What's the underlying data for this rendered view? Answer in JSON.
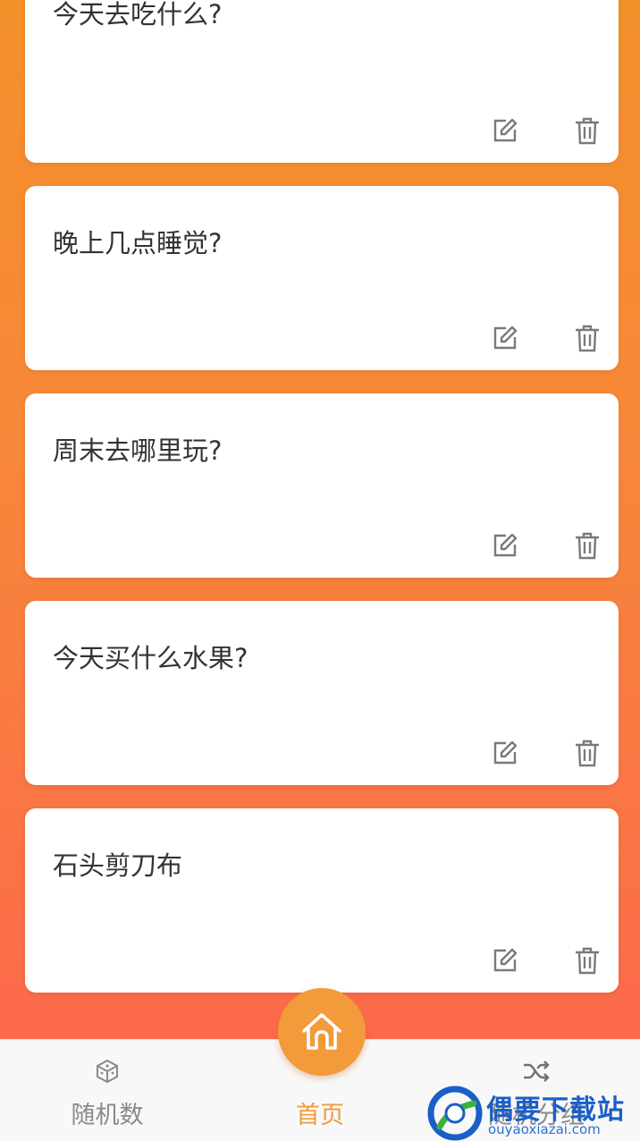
{
  "cards": [
    {
      "title": "今天去吃什么?"
    },
    {
      "title": "晚上几点睡觉?"
    },
    {
      "title": "周末去哪里玩?"
    },
    {
      "title": "今天买什么水果?"
    },
    {
      "title": "石头剪刀布"
    }
  ],
  "card_icons": {
    "edit": "edit-icon",
    "delete": "trash-icon"
  },
  "tabbar": {
    "random": {
      "label": "随机数",
      "icon": "dice-icon"
    },
    "home": {
      "label": "首页",
      "icon": "home-icon"
    },
    "group": {
      "label": "随机分组",
      "icon": "shuffle-icon"
    }
  },
  "watermark": {
    "title": "偶要下载站",
    "url": "ouyaoxiazai.com"
  },
  "colors": {
    "gradient_top": "#f4902a",
    "gradient_bottom": "#fe6450",
    "accent": "#f39a3a",
    "card_bg": "#ffffff",
    "text": "#333333",
    "icon": "#7a7a7a"
  }
}
